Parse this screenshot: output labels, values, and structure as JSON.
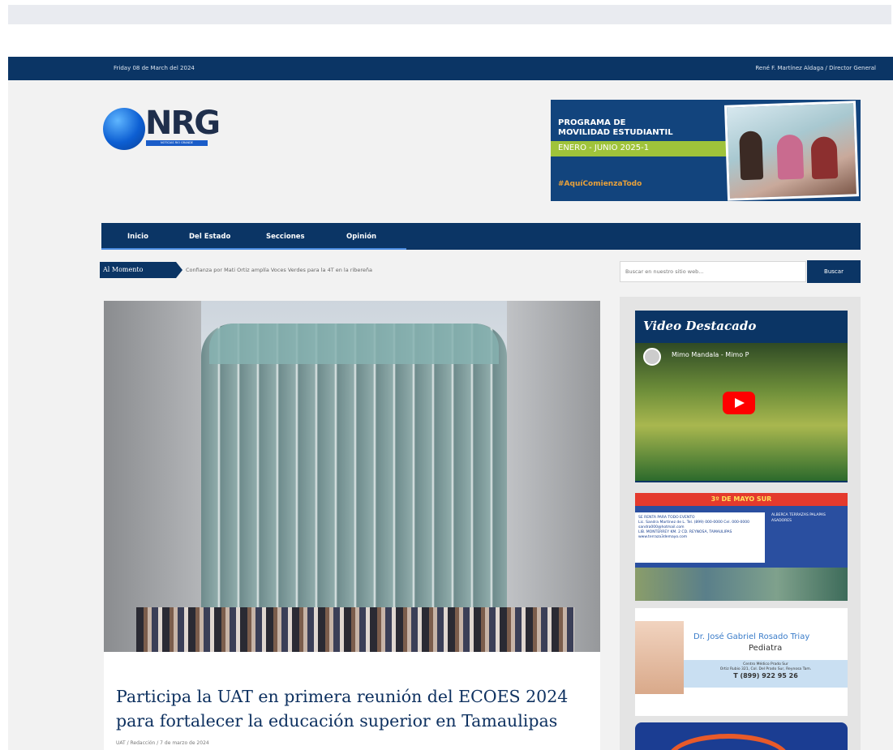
{
  "topbar": {
    "date": "Friday 08 de March del 2024",
    "director": "René F. Martínez Aldaga / Director General"
  },
  "logo": {
    "text": "NRG",
    "tagline": "NOTICIAS RIO GRANDE"
  },
  "ad_banner": {
    "line1": "PROGRAMA DE",
    "line2": "MOVILIDAD ESTUDIANTIL",
    "line3": "ENERO - JUNIO 2025-1",
    "line4": "#AquíComienzaTodo"
  },
  "nav": {
    "items": [
      "Inicio",
      "Del Estado",
      "Secciones",
      "Opinión"
    ]
  },
  "ticker": {
    "label": "Al Momento",
    "text": "Confianza por Mati Ortiz amplía Voces Verdes para la 4T en la ribereña"
  },
  "search": {
    "placeholder": "Buscar en nuestro sitio web...",
    "button": "Buscar"
  },
  "article": {
    "title": "Participa la UAT en primera reunión del ECOES 2024 para fortalecer la educación superior en Tamaulipas",
    "meta": "UAT / Redacción / 7 de marzo de 2024"
  },
  "sidebar": {
    "video_title": "Video Destacado",
    "video_caption": "Mimo Mandala - Mimo P",
    "ad2": {
      "header": "3º DE MAYO SUR",
      "sub": "SE RENTA PARA TODO EVENTO",
      "contact": "Lic. Sandra Martínez de L.  Tel. (899) 000-0000  Cel. 000-0000  sandra000@hotmail.com",
      "address": "LIB. MONTERREY KM. 2  CD. REYNOSA, TAMAULIPAS  www.terraza3demayo.com",
      "side": "ALBERCA  TERRAZAS  PALAPAS  ASADORES"
    },
    "ad3": {
      "name": "Dr. José Gabriel Rosado Triay",
      "specialty": "Pediatra",
      "clinic": "Centro Médico Prado Sur",
      "address": "Ortiz Rubio 321, Col. Del Prado Sur, Reynosa Tam.",
      "phone": "T (899) 922 95 26"
    }
  }
}
